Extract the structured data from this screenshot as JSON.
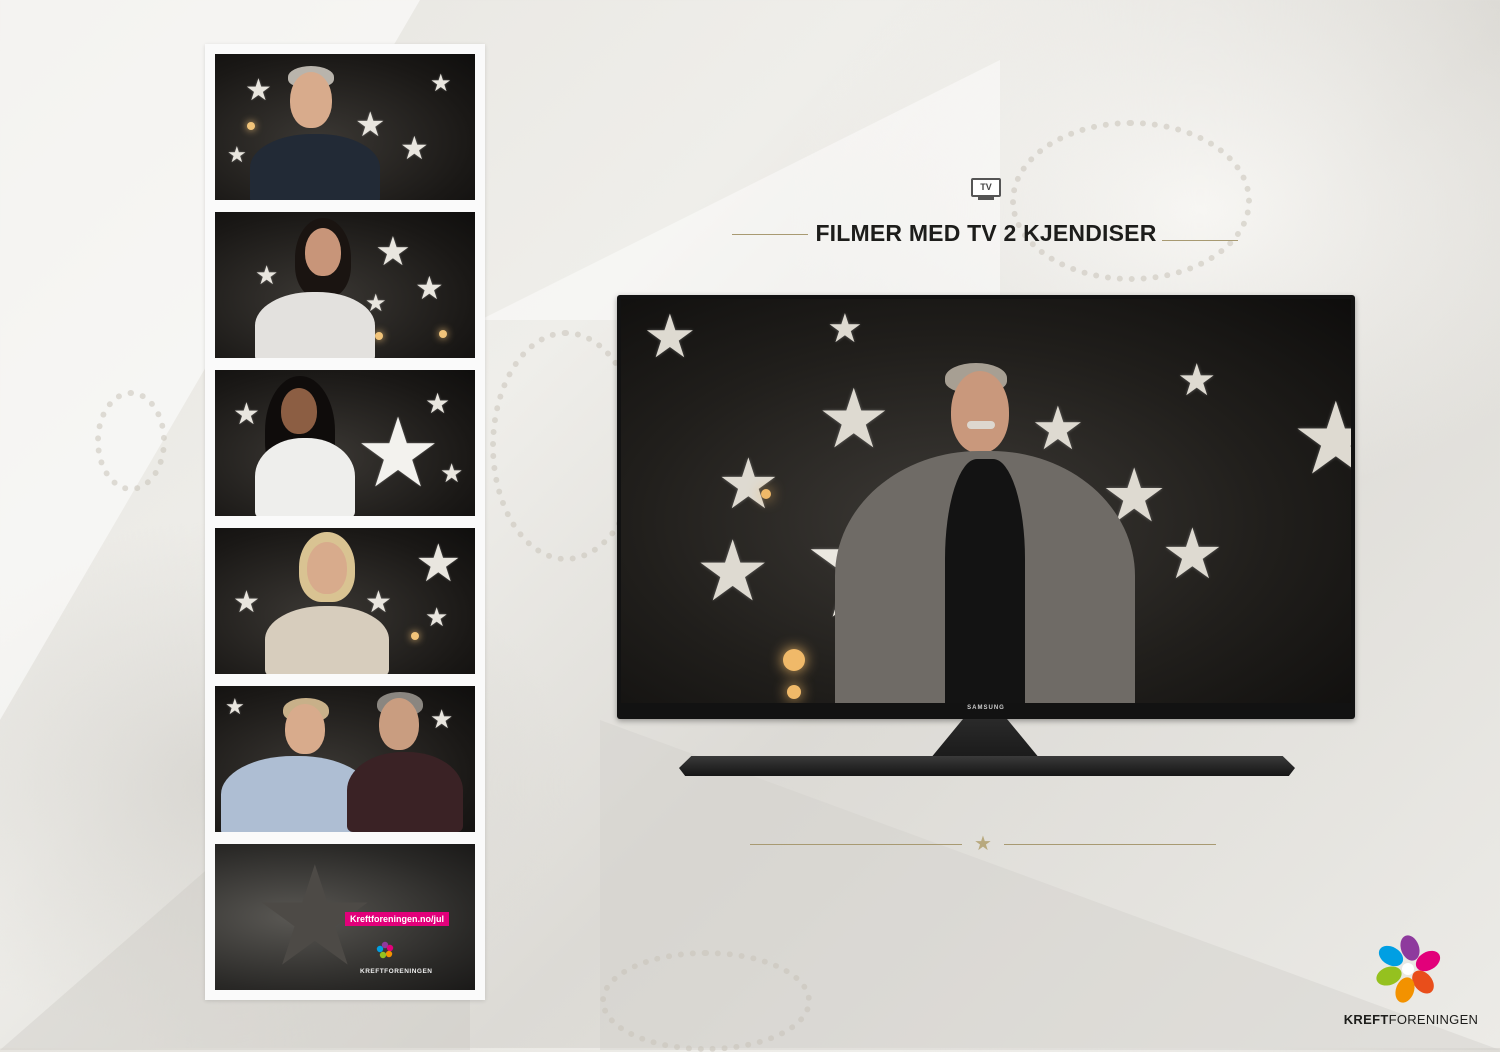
{
  "header": {
    "tv_icon_label": "TV",
    "title": "FILMER MED TV 2 KJENDISER"
  },
  "tv": {
    "brand": "SAMSUNG"
  },
  "filmstrip": {
    "end_card": {
      "url": "Kreftforeningen.no/jul",
      "brand": "KREFTFORENINGEN"
    }
  },
  "logo": {
    "brand_bold": "KREFT",
    "brand_regular": "FORENINGEN"
  },
  "colors": {
    "accent_gold": "#a89a72",
    "brand_pink": "#e2007a",
    "title_dark": "#1d1d1b"
  },
  "icons": [
    "tv-icon",
    "star-icon",
    "kreftforeningen-logo"
  ]
}
